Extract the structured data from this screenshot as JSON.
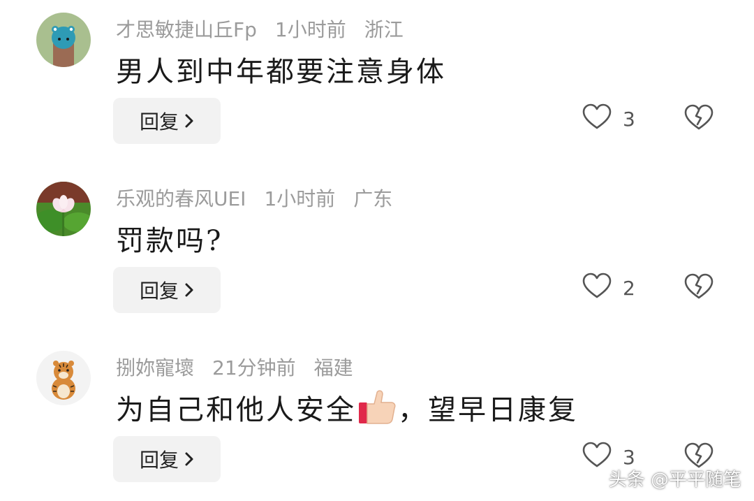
{
  "comments": [
    {
      "username": "才思敏捷山丘Fp",
      "time": "1小时前",
      "location": "浙江",
      "text": "男人到中年都要注意身体",
      "reply_label": "回复",
      "likes": "3",
      "avatar_icon": "blue-creature-avatar"
    },
    {
      "username": "乐观的春风UEI",
      "time": "1小时前",
      "location": "广东",
      "text": "罚款吗?",
      "reply_label": "回复",
      "likes": "2",
      "avatar_icon": "lotus-avatar"
    },
    {
      "username": "捌妳寵壞",
      "time": "21分钟前",
      "location": "福建",
      "text_before": "为自己和他人安全",
      "text_after": "，望早日康复",
      "reply_label": "回复",
      "likes": "3",
      "avatar_icon": "tiger-avatar",
      "emoji_icon": "thumbs-up-icon"
    }
  ],
  "watermark": "头条 @平平随笔",
  "colors": {
    "meta_text": "#9b9b9b",
    "body_text": "#1a1a1a",
    "reply_bg": "#f2f2f2",
    "icon_stroke": "#555555"
  }
}
